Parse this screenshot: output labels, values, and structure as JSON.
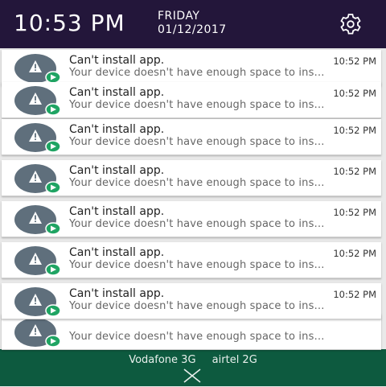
{
  "header": {
    "time": "10:53 PM",
    "day": "FRIDAY",
    "date": "01/12/2017",
    "settings_icon": "gear-icon"
  },
  "notifications": [
    {
      "title": "Can't install app.",
      "time": "10:52 PM",
      "body": "Your device doesn't have enough space to ins…"
    },
    {
      "title": "Can't install app.",
      "time": "10:52 PM",
      "body": "Your device doesn't have enough space to ins…"
    },
    {
      "title": "Can't install app.",
      "time": "10:52 PM",
      "body": "Your device doesn't have enough space to ins…"
    },
    {
      "title": "Can't install app.",
      "time": "10:52 PM",
      "body": "Your device doesn't have enough space to ins…"
    },
    {
      "title": "Can't install app.",
      "time": "10:52 PM",
      "body": "Your device doesn't have enough space to ins…"
    },
    {
      "title": "Can't install app.",
      "time": "10:52 PM",
      "body": "Your device doesn't have enough space to ins…"
    },
    {
      "title": "Can't install app.",
      "time": "10:52 PM",
      "body": "Your device doesn't have enough space to ins…"
    },
    {
      "title": "",
      "time": "",
      "body": "Your device doesn't have enough space to ins…"
    }
  ],
  "footer": {
    "carrier_1": "Vodafone 3G",
    "carrier_2": "airtel 2G",
    "close_icon": "close-icon"
  },
  "colors": {
    "header_bg": "#23163a",
    "icon_gray": "#5f6f7c",
    "badge_green": "#1fa463",
    "footer_bg": "#0d5a3f"
  }
}
